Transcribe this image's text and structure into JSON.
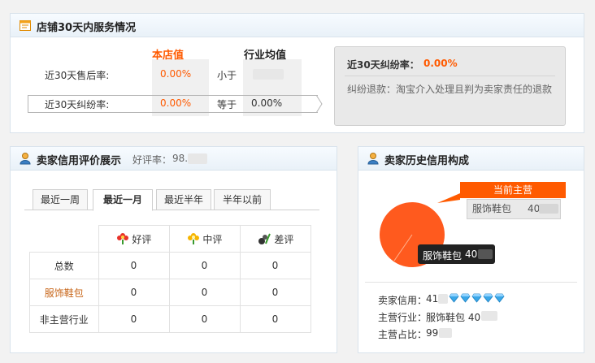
{
  "service": {
    "title": "店铺30天内服务情况",
    "col_store": "本店值",
    "col_industry": "行业均值",
    "rows": [
      {
        "label": "近30天售后率:",
        "store": "0.00%",
        "cmp": "小于",
        "industry": ""
      },
      {
        "label": "近30天纠纷率:",
        "store": "0.00%",
        "cmp": "等于",
        "industry": "0.00%"
      }
    ],
    "detail": {
      "title_prefix": "近30天纠纷率：",
      "title_value": "0.00%",
      "desc": "纠纷退款：淘宝介入处理且判为卖家责任的退款"
    }
  },
  "rating": {
    "title": "卖家信用评价展示",
    "good_rate_label": "好评率：",
    "good_rate_value": "98.",
    "tabs": [
      "最近一周",
      "最近一月",
      "最近半年",
      "半年以前"
    ],
    "active_tab": 1,
    "headers": [
      "好评",
      "中评",
      "差评"
    ],
    "rows": [
      {
        "label": "总数",
        "values": [
          "0",
          "0",
          "0"
        ],
        "highlight": false
      },
      {
        "label": "服饰鞋包",
        "values": [
          "0",
          "0",
          "0"
        ],
        "highlight": true
      },
      {
        "label": "非主营行业",
        "values": [
          "0",
          "0",
          "0"
        ],
        "highlight": false
      }
    ]
  },
  "history": {
    "title": "卖家历史信用构成",
    "legend_header": "当前主营",
    "legend_item": "服饰鞋包",
    "legend_value": "40",
    "tooltip_label": "服饰鞋包",
    "tooltip_value": "40",
    "credit_label": "卖家信用：",
    "credit_value": "41",
    "industry_label": "主营行业：",
    "industry_value": "服饰鞋包 40",
    "share_label": "主营占比：",
    "share_value": "99",
    "colors": {
      "pie": "#ff5a1e",
      "accent": "#ff5a00",
      "diamond": "#3aa7e8"
    }
  },
  "chart_data": {
    "type": "pie",
    "categories": [
      "服饰鞋包"
    ],
    "values": [
      100
    ],
    "title": "",
    "legend": "top-right"
  }
}
